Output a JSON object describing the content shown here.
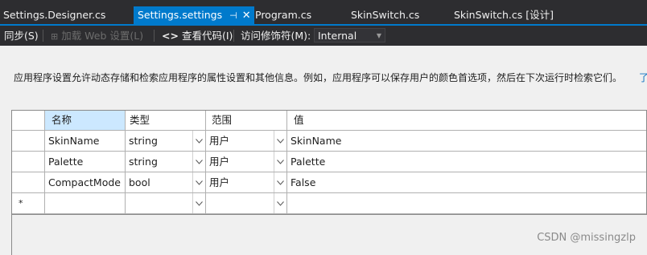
{
  "tabs": [
    {
      "label": "Settings.Designer.cs",
      "active": false
    },
    {
      "label": "Settings.settings",
      "active": true,
      "pin_icon": "pin-icon",
      "close_icon": "close-icon"
    },
    {
      "label": "Program.cs",
      "active": false
    },
    {
      "label": "SkinSwitch.cs",
      "active": false
    },
    {
      "label": "SkinSwitch.cs [设计]",
      "active": false
    }
  ],
  "toolbar": {
    "sync_label": "同步(S)",
    "load_web_label": "加载 Web 设置(L)",
    "view_code_label": "查看代码(I)",
    "access_modifier_label": "访问修饰符(M):",
    "access_modifier_value": "Internal"
  },
  "description": "应用程序设置允许动态存储和检索应用程序的属性设置和其他信息。例如，应用程序可以保存用户的颜色首选项，然后在下次运行时检索它们。",
  "learn_more_link": "了",
  "grid": {
    "columns": [
      "名称",
      "类型",
      "范围",
      "值"
    ],
    "rows": [
      {
        "name": "SkinName",
        "type": "string",
        "scope": "用户",
        "value": "SkinName"
      },
      {
        "name": "Palette",
        "type": "string",
        "scope": "用户",
        "value": "Palette"
      },
      {
        "name": "CompactMode",
        "type": "bool",
        "scope": "用户",
        "value": "False"
      }
    ],
    "new_row_marker": "*"
  },
  "watermark": "CSDN @missingzlp",
  "colors": {
    "accent": "#007acc",
    "chrome": "#2d2d30",
    "header_selected": "#cce8ff"
  }
}
